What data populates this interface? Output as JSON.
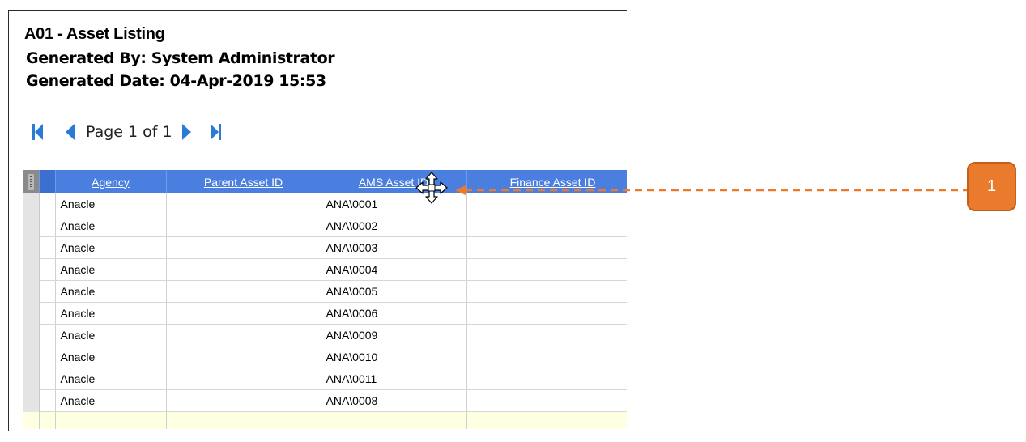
{
  "report": {
    "title": "A01 - Asset Listing",
    "generated_by": "Generated By: System Administrator",
    "generated_date": "Generated Date: 04-Apr-2019 15:53"
  },
  "pager": {
    "page_text": "Page 1 of 1",
    "first_icon": "first-page-icon",
    "prev_icon": "previous-page-icon",
    "next_icon": "next-page-icon",
    "last_icon": "last-page-icon"
  },
  "grid": {
    "columns": [
      "Agency",
      "Parent Asset ID",
      "AMS Asset ID",
      "Finance Asset ID"
    ],
    "rows": [
      {
        "agency": "Anacle",
        "parent": "",
        "ams": "ANA\\0001",
        "finance": ""
      },
      {
        "agency": "Anacle",
        "parent": "",
        "ams": "ANA\\0002",
        "finance": ""
      },
      {
        "agency": "Anacle",
        "parent": "",
        "ams": "ANA\\0003",
        "finance": ""
      },
      {
        "agency": "Anacle",
        "parent": "",
        "ams": "ANA\\0004",
        "finance": ""
      },
      {
        "agency": "Anacle",
        "parent": "",
        "ams": "ANA\\0005",
        "finance": ""
      },
      {
        "agency": "Anacle",
        "parent": "",
        "ams": "ANA\\0006",
        "finance": ""
      },
      {
        "agency": "Anacle",
        "parent": "",
        "ams": "ANA\\0009",
        "finance": ""
      },
      {
        "agency": "Anacle",
        "parent": "",
        "ams": "ANA\\0010",
        "finance": ""
      },
      {
        "agency": "Anacle",
        "parent": "",
        "ams": "ANA\\0011",
        "finance": ""
      },
      {
        "agency": "Anacle",
        "parent": "",
        "ams": "ANA\\0008",
        "finance": ""
      }
    ]
  },
  "callout": {
    "label": "1",
    "color": "#ea7a2c"
  },
  "colors": {
    "header_blue": "#4a7fe0",
    "new_row_yellow": "#ffffe1"
  }
}
